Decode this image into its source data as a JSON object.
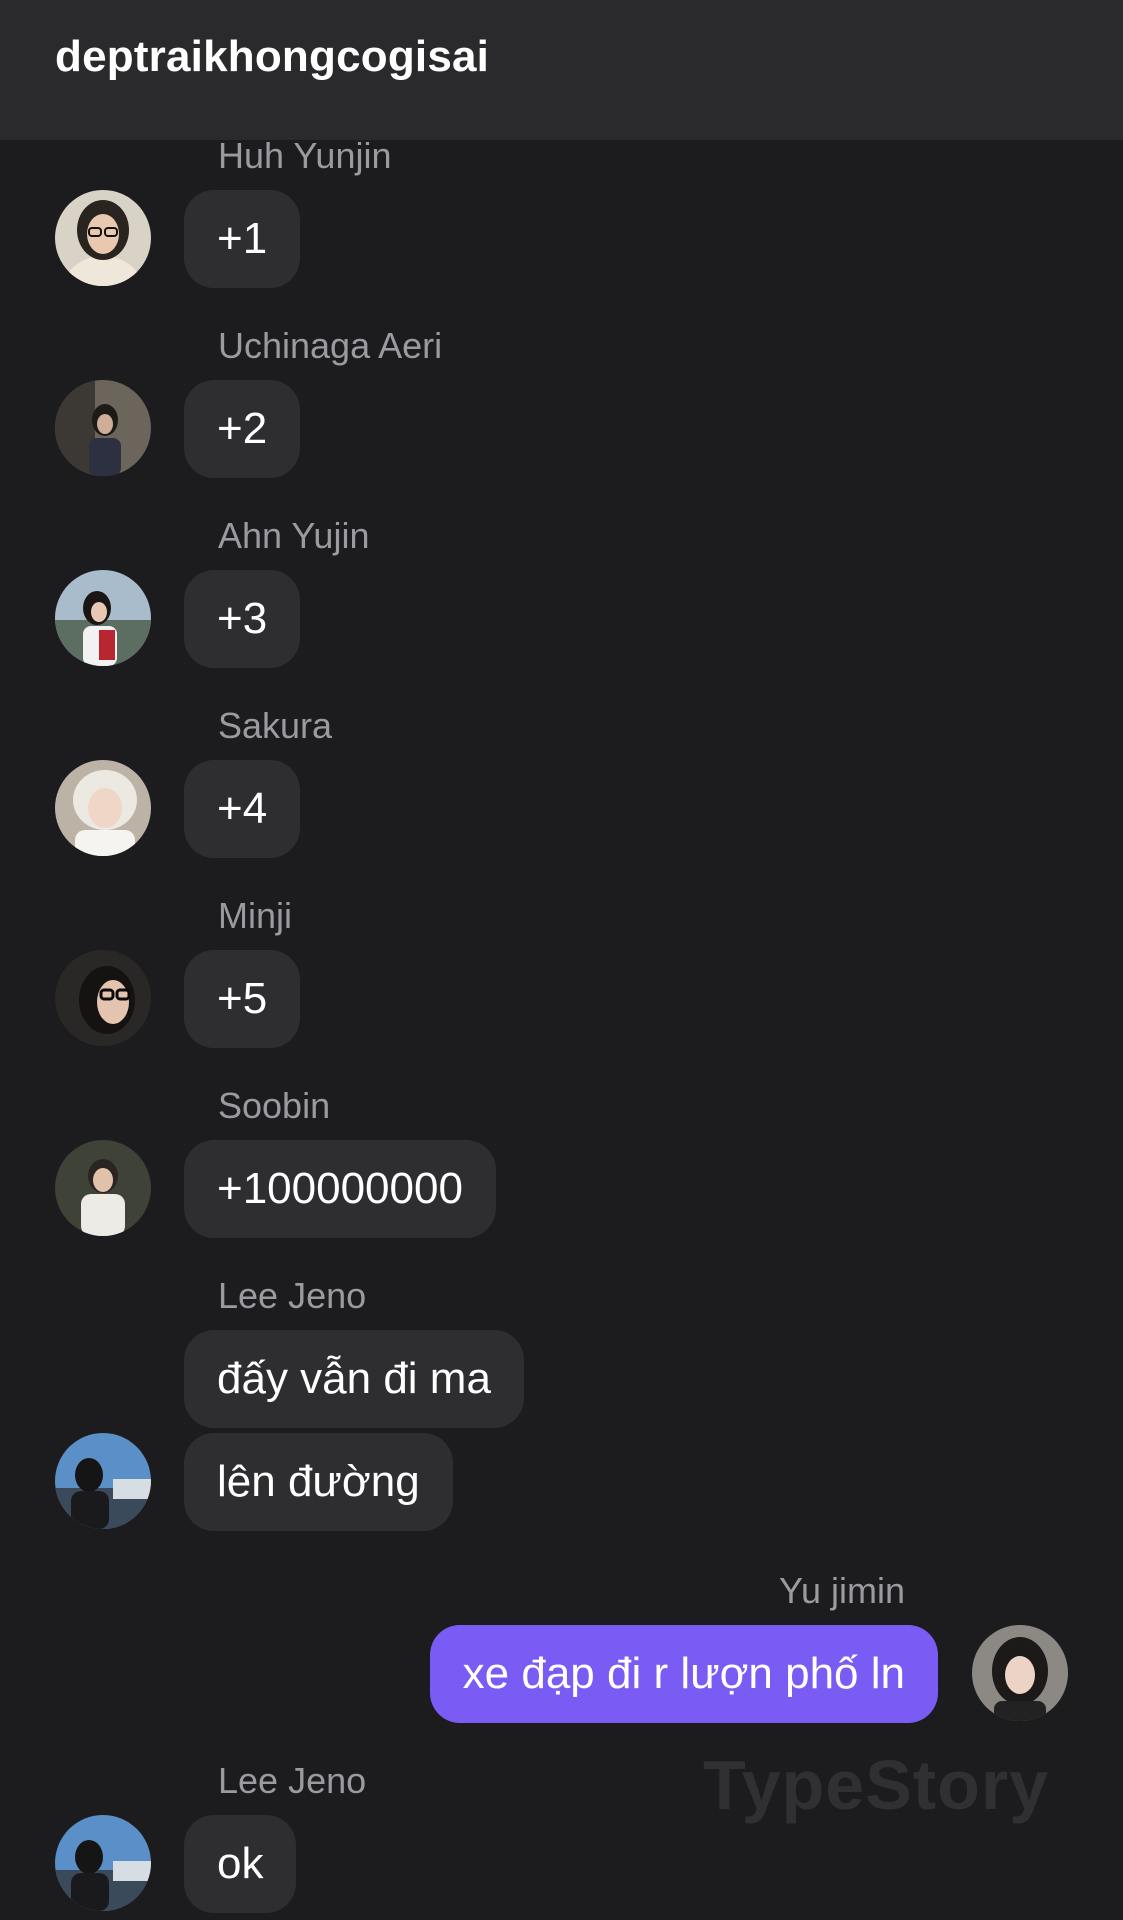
{
  "header": {
    "title": "deptraikhongcogisai"
  },
  "messages": [
    {
      "sender": "Huh Yunjin",
      "text": "+1"
    },
    {
      "sender": "Uchinaga Aeri",
      "text": "+2"
    },
    {
      "sender": "Ahn Yujin",
      "text": "+3"
    },
    {
      "sender": "Sakura",
      "text": "+4"
    },
    {
      "sender": "Minji",
      "text": "+5"
    },
    {
      "sender": "Soobin",
      "text": "+100000000"
    },
    {
      "sender": "Lee Jeno",
      "texts": [
        "đấy vẫn đi ma",
        "lên đường"
      ]
    },
    {
      "sender": "Yu jimin",
      "text": "xe đạp đi r lượn phố ln",
      "mine": true
    },
    {
      "sender": "Lee Jeno",
      "text": "ok"
    }
  ],
  "watermark": "TypeStory",
  "colors": {
    "background": "#1c1c1e",
    "header": "#2a2a2c",
    "bubble_received": "#2e2e31",
    "bubble_sent": "#7a5cf5",
    "sender_name": "#9a9aa0"
  }
}
